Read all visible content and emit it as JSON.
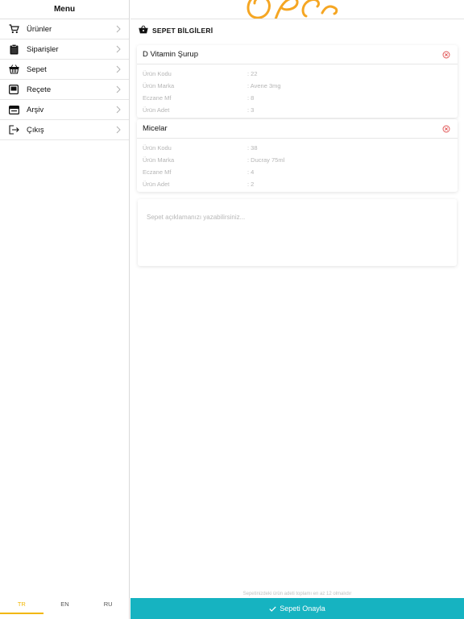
{
  "sidebar": {
    "title": "Menu",
    "items": [
      {
        "label": "Ürünler",
        "icon": "cart-icon"
      },
      {
        "label": "Siparişler",
        "icon": "clipboard-icon"
      },
      {
        "label": "Sepet",
        "icon": "basket-icon"
      },
      {
        "label": "Reçete",
        "icon": "prescription-icon"
      },
      {
        "label": "Arşiv",
        "icon": "archive-icon"
      },
      {
        "label": "Çıkış",
        "icon": "logout-icon"
      }
    ],
    "languages": [
      "TR",
      "EN",
      "RU"
    ],
    "active_language": "TR"
  },
  "main": {
    "section_title": "SEPET BİLGİLERİ",
    "section_icon": "basket-icon",
    "cart_items": [
      {
        "name": "D Vitamin Şurup",
        "fields": [
          {
            "label": "Ürün Kodu",
            "value": ": 22"
          },
          {
            "label": "Ürün Marka",
            "value": ": Avene 3mg"
          },
          {
            "label": "Eczane Mf",
            "value": ": 8"
          },
          {
            "label": "Ürün Adet",
            "value": ": 3"
          }
        ]
      },
      {
        "name": "Micelar",
        "fields": [
          {
            "label": "Ürün Kodu",
            "value": ": 38"
          },
          {
            "label": "Ürün Marka",
            "value": ": Ducray 75ml"
          },
          {
            "label": "Eczane Mf",
            "value": ": 4"
          },
          {
            "label": "Ürün Adet",
            "value": ": 2"
          }
        ]
      }
    ],
    "note_placeholder": "Sepet açıklamanızı yazabilirsiniz...",
    "footer_note": "Sepetinizdeki ürün adeti toplamı en az 12 olmalıdır",
    "confirm_label": "Sepeti Onayla"
  },
  "colors": {
    "accent": "#16b3c1",
    "active_language": "#f2b705",
    "brand_logo": "#f5a623",
    "remove_icon": "#e05050"
  }
}
